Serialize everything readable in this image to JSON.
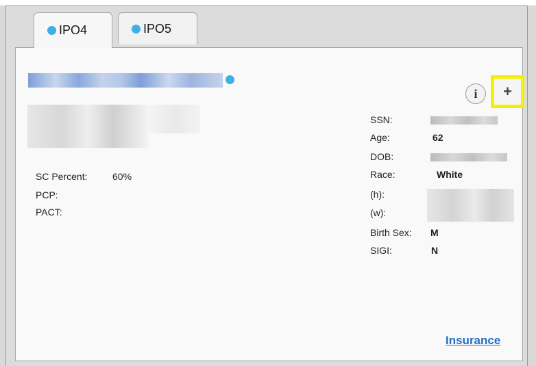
{
  "tabs": [
    {
      "label": "IPO4",
      "dot_color": "#3fb0e6"
    },
    {
      "label": "IPO5",
      "dot_color": "#3fb0e6"
    }
  ],
  "patient": {
    "sc_percent_label": "SC Percent:",
    "sc_percent_value": "60%",
    "pcp_label": "PCP:",
    "pact_label": "PACT:"
  },
  "demographics": {
    "ssn_label": "SSN:",
    "age_label": "Age:",
    "age_value": "62",
    "dob_label": "DOB:",
    "race_label": "Race:",
    "race_value": "White",
    "home_phone_label": "(h):",
    "work_phone_label": "(w):",
    "birth_sex_label": "Birth Sex:",
    "birth_sex_value": "M",
    "sigi_label": "SIGI:",
    "sigi_value": "N"
  },
  "buttons": {
    "info_glyph": "i",
    "add_glyph": "+",
    "add_highlight_color": "#f5f000"
  },
  "links": {
    "insurance": "Insurance"
  }
}
